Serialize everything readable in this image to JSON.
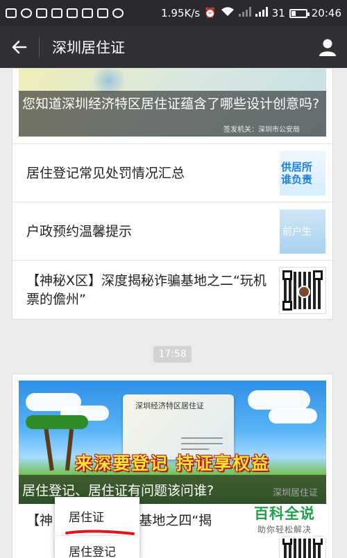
{
  "status_bar": {
    "network_speed": "1.95K/s",
    "battery_level": "31",
    "time": "20:46"
  },
  "nav": {
    "title": "深圳居住证"
  },
  "articles_group1": {
    "cover_caption": "您知道深圳经济特区居住证蕴含了哪些设计创意吗?",
    "cover_issuer": "签发机关：深圳市公安局",
    "items": [
      {
        "title": "居住登记常见处罚情况汇总",
        "thumb_text": "供居所\n谁负责"
      },
      {
        "title": "户政预约温馨提示",
        "thumb_text": "前户生"
      },
      {
        "title": "【神秘X区】深度揭秘诈骗基地之二“玩机票的儋州”"
      }
    ]
  },
  "time_chip": "17:58",
  "articles_group2": {
    "cover_idcard_title": "深圳经济特区居住证",
    "cover_slogan": "来深要登记 持证享权益",
    "cover_caption": "居住登记、居住证有问题该问谁?",
    "cover_watermark": "深圳居住证",
    "item_title_visible": "【神        揭秘诈骗基地之四“揭"
  },
  "popup_menu": {
    "items": [
      "居住证",
      "居住登记"
    ]
  },
  "watermark": {
    "brand": "百科全说",
    "tagline": "助你轻松解决"
  }
}
